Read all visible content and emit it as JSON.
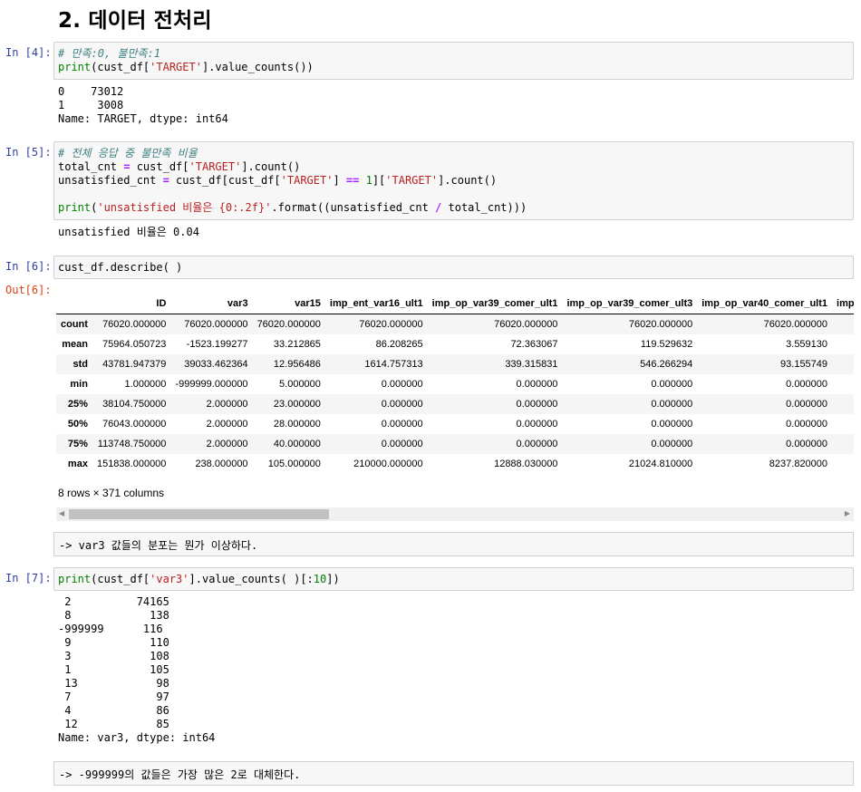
{
  "heading": "2. 데이터 전처리",
  "cells": {
    "c4": {
      "prompt": "In [4]:",
      "comment": "# 만족:0, 불만족:1",
      "code": [
        "print(cust_df['TARGET'].value_counts())"
      ],
      "output": [
        "0    73012",
        "1     3008",
        "Name: TARGET, dtype: int64"
      ]
    },
    "c5": {
      "prompt": "In [5]:",
      "comment": "# 전체 응답 중 불만족 비율",
      "line2": "total_cnt = cust_df['TARGET'].count()",
      "line3": "unsatisfied_cnt = cust_df[cust_df['TARGET'] == 1]['TARGET'].count()",
      "line5": "print('unsatisfied 비율은 {0:.2f}'.format((unsatisfied_cnt / total_cnt)))",
      "output": "unsatisfied 비율은 0.04"
    },
    "c6": {
      "prompt": "In [6]:",
      "code": "cust_df.describe( )",
      "out_prompt": "Out[6]:"
    },
    "md1": "-> var3 값들의 분포는 뭔가 이상하다.",
    "c7": {
      "prompt": "In [7]:",
      "code": "print(cust_df['var3'].value_counts( )[:10])",
      "output": [
        " 2          74165",
        " 8            138",
        "-999999      116",
        " 9            110",
        " 3            108",
        " 1            105",
        " 13            98",
        " 7             97",
        " 4             86",
        " 12            85",
        "Name: var3, dtype: int64"
      ]
    },
    "md2": "-> -999999의 값들은 가장 많은 2로 대체한다."
  },
  "describe_table": {
    "columns": [
      "",
      "ID",
      "var3",
      "var15",
      "imp_ent_var16_ult1",
      "imp_op_var39_comer_ult1",
      "imp_op_var39_comer_ult3",
      "imp_op_var40_comer_ult1",
      "imp_"
    ],
    "rows": [
      [
        "count",
        "76020.000000",
        "76020.000000",
        "76020.000000",
        "76020.000000",
        "76020.000000",
        "76020.000000",
        "76020.000000",
        ""
      ],
      [
        "mean",
        "75964.050723",
        "-1523.199277",
        "33.212865",
        "86.208265",
        "72.363067",
        "119.529632",
        "3.559130",
        ""
      ],
      [
        "std",
        "43781.947379",
        "39033.462364",
        "12.956486",
        "1614.757313",
        "339.315831",
        "546.266294",
        "93.155749",
        ""
      ],
      [
        "min",
        "1.000000",
        "-999999.000000",
        "5.000000",
        "0.000000",
        "0.000000",
        "0.000000",
        "0.000000",
        ""
      ],
      [
        "25%",
        "38104.750000",
        "2.000000",
        "23.000000",
        "0.000000",
        "0.000000",
        "0.000000",
        "0.000000",
        ""
      ],
      [
        "50%",
        "76043.000000",
        "2.000000",
        "28.000000",
        "0.000000",
        "0.000000",
        "0.000000",
        "0.000000",
        ""
      ],
      [
        "75%",
        "113748.750000",
        "2.000000",
        "40.000000",
        "0.000000",
        "0.000000",
        "0.000000",
        "0.000000",
        ""
      ],
      [
        "max",
        "151838.000000",
        "238.000000",
        "105.000000",
        "210000.000000",
        "12888.030000",
        "21024.810000",
        "8237.820000",
        ""
      ]
    ],
    "shape_info": "8 rows × 371 columns"
  },
  "icons": {
    "scroll_left": "arrow-left-icon",
    "scroll_right": "arrow-right-icon"
  }
}
